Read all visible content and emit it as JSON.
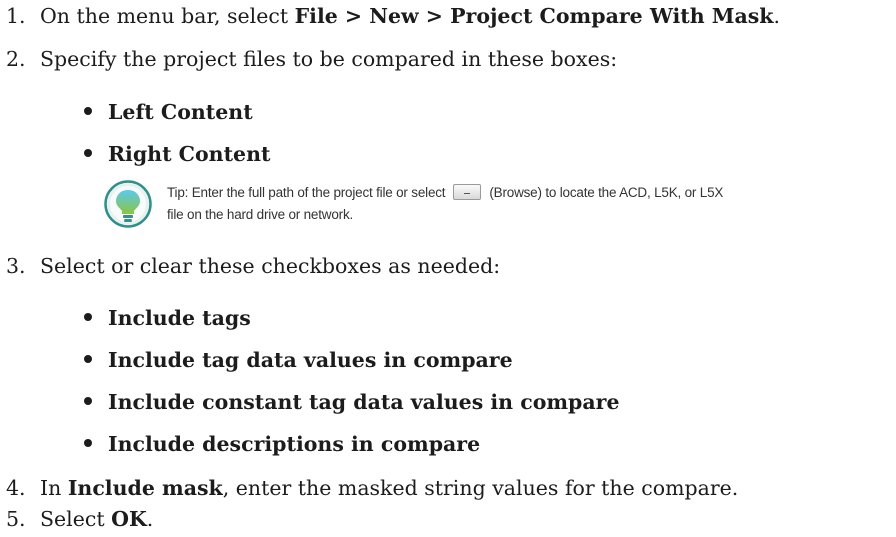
{
  "steps": [
    {
      "num": "1.",
      "pre": "On the menu bar, select ",
      "bold": "File > New > Project Compare With Mask",
      "post": "."
    },
    {
      "num": "2.",
      "text": "Specify the project files to be compared in these boxes:"
    },
    {
      "num": "3.",
      "text": "Select or clear these checkboxes as needed:"
    },
    {
      "num": "4.",
      "pre": "In ",
      "bold": "Include mask",
      "post": ", enter the masked string values for the compare."
    },
    {
      "num": "5.",
      "pre": "Select ",
      "bold": "OK",
      "post": "."
    }
  ],
  "content_boxes": [
    "Left Content",
    "Right Content"
  ],
  "tip": {
    "part1": "Tip: Enter the full path of the project file or select",
    "part2": "(Browse) to locate the ACD, L5K, or L5X",
    "part3": "file on the hard drive or network.",
    "icon": "lightbulb-icon",
    "colors": {
      "ring": "#2f8f8a",
      "bulb_top": "#5bc8f0",
      "bulb_bottom": "#8cc63f"
    }
  },
  "checkboxes": [
    "Include tags",
    "Include tag data values in compare",
    "Include constant tag data values in compare",
    "Include descriptions in compare"
  ]
}
